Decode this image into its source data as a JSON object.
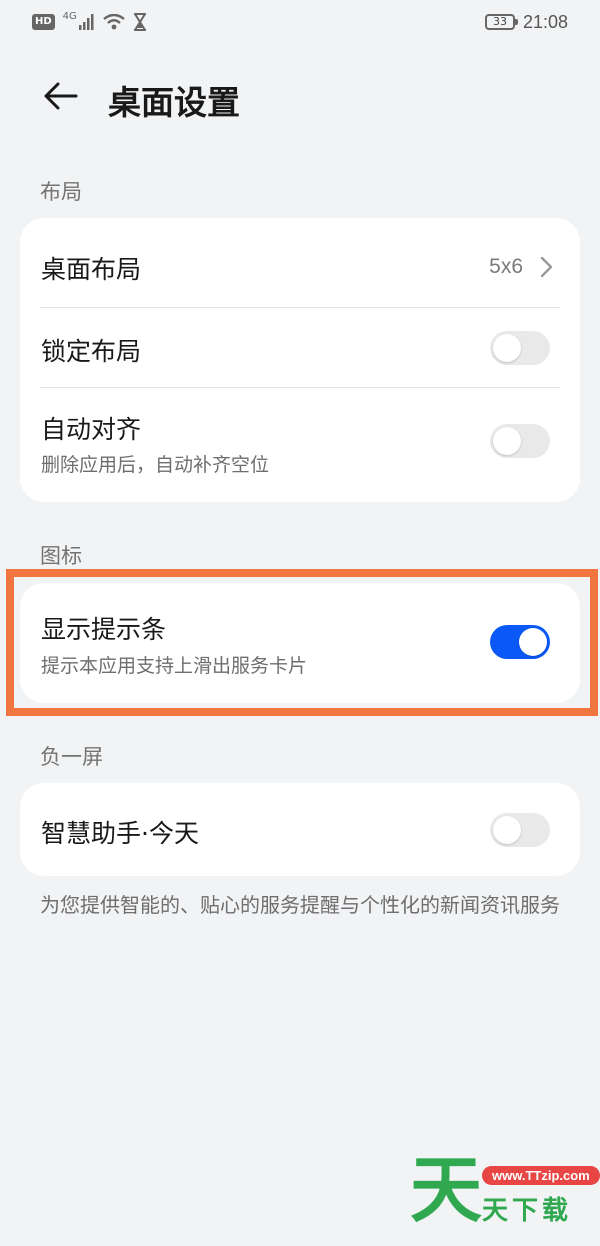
{
  "status_bar": {
    "hd": "HD",
    "network": "4G",
    "battery": "33",
    "time": "21:08"
  },
  "header": {
    "title": "桌面设置"
  },
  "sections": {
    "layout": {
      "label": "布局",
      "desktop_layout": {
        "title": "桌面布局",
        "value": "5x6"
      },
      "lock_layout": {
        "title": "锁定布局",
        "enabled": false
      },
      "auto_align": {
        "title": "自动对齐",
        "subtitle": "删除应用后，自动补齐空位",
        "enabled": false
      }
    },
    "icons": {
      "label": "图标",
      "show_hint_bar": {
        "title": "显示提示条",
        "subtitle": "提示本应用支持上滑出服务卡片",
        "enabled": true
      }
    },
    "minus_one": {
      "label": "负一屏",
      "smart_assistant": {
        "title": "智慧助手·今天",
        "enabled": false
      },
      "footnote": "为您提供智能的、贴心的服务提醒与个性化的新闻资讯服务"
    }
  },
  "watermark": {
    "big_char": "天",
    "url": "www.TTzip.com",
    "name": "天下载"
  },
  "colors": {
    "accent": "#0a59f7",
    "highlight": "#f0753f",
    "background": "#f1f3f5"
  }
}
